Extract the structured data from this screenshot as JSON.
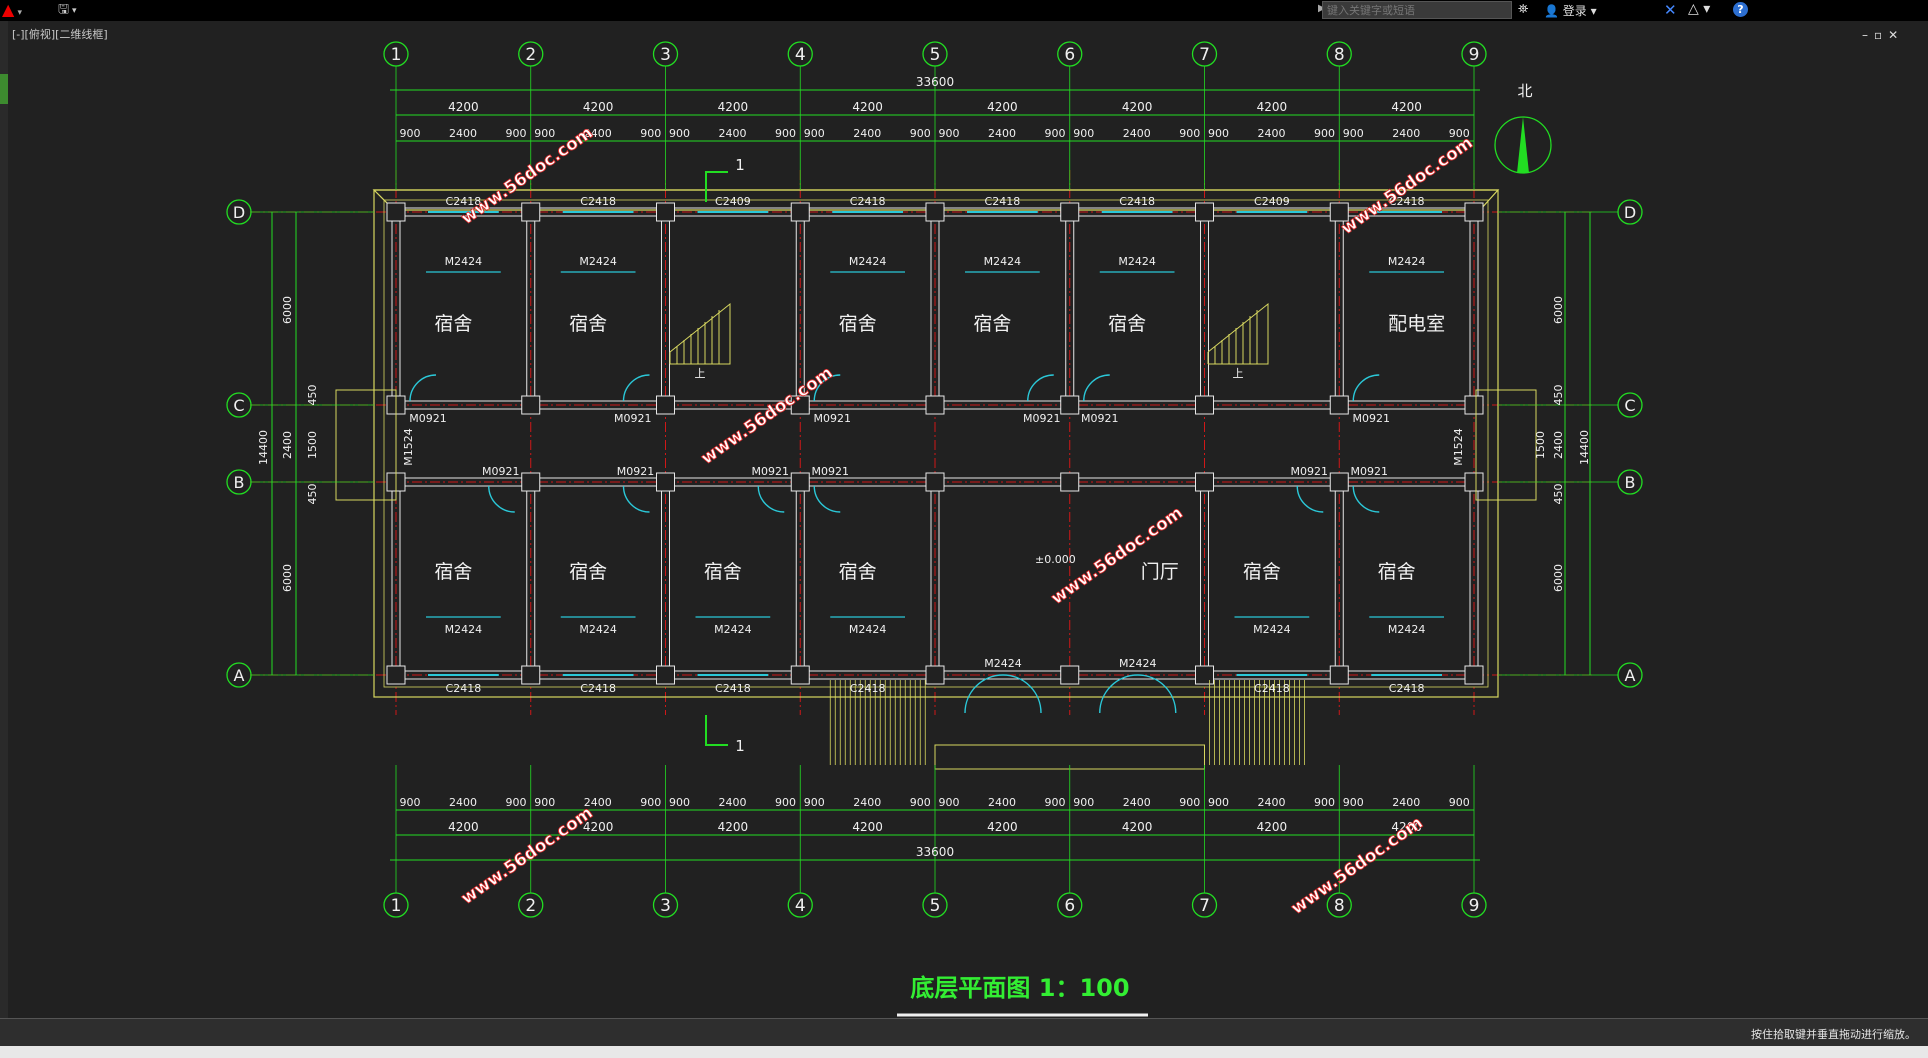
{
  "toolbar": {
    "app_menu_icon": "autocad-a-icon",
    "search_placeholder": "键入关键字或短语",
    "login_label": "登录",
    "help_label": "?"
  },
  "viewport": {
    "label": "[-][俯视][二维线框]"
  },
  "status": {
    "hint": "按住拾取键并垂直拖动进行缩放。"
  },
  "drawing": {
    "title": "底层平面图 1：100",
    "north_label": "北",
    "total_dim": "33600",
    "bay_dim": "4200",
    "col_axes": [
      "1",
      "2",
      "3",
      "4",
      "5",
      "6",
      "7",
      "8",
      "9"
    ],
    "row_axes": [
      "D",
      "C",
      "B",
      "A"
    ],
    "top_sub_dims": [
      "900",
      "2400",
      "900",
      "900",
      "2400",
      "900",
      "900",
      "2400",
      "900",
      "900",
      "2400",
      "900",
      "900",
      "2400",
      "900",
      "900",
      "2400",
      "900",
      "900",
      "2400",
      "900",
      "900",
      "2400",
      "900"
    ],
    "side_dims": {
      "total": "14400",
      "room": "6000",
      "corridor": "2400",
      "wall": "450",
      "door": "1500"
    },
    "window_labels_top": [
      "C2418",
      "C2418",
      "C2409",
      "C2418",
      "C2418",
      "C2418",
      "C2409",
      "C2418"
    ],
    "window_labels_bottom": [
      "C2418",
      "C2418",
      "C2418",
      "C2418",
      "C2418",
      "C2418"
    ],
    "top_rooms": [
      "宿舍",
      "宿舍",
      "宿舍",
      "宿舍",
      "宿舍",
      "配电室"
    ],
    "bottom_rooms": [
      "宿舍",
      "宿舍",
      "宿舍",
      "宿舍",
      "宿舍",
      "宿舍"
    ],
    "hall_label": "门厅",
    "elevation": "±0.000",
    "door_m2424": "M2424",
    "door_m0921": "M0921",
    "door_m1524": "M1524",
    "stair_label": "上",
    "section_mark": "1",
    "watermark": "www.56doc.com"
  },
  "colors": {
    "background": "#212121",
    "grid_green": "#22dd22",
    "axis_red": "#d01818",
    "wall_white": "#e8e8e8",
    "outline_yellow": "#d8d860",
    "window_cyan": "#2bc8d8",
    "watermark_red": "#e02828",
    "title_green": "#33ee33"
  }
}
